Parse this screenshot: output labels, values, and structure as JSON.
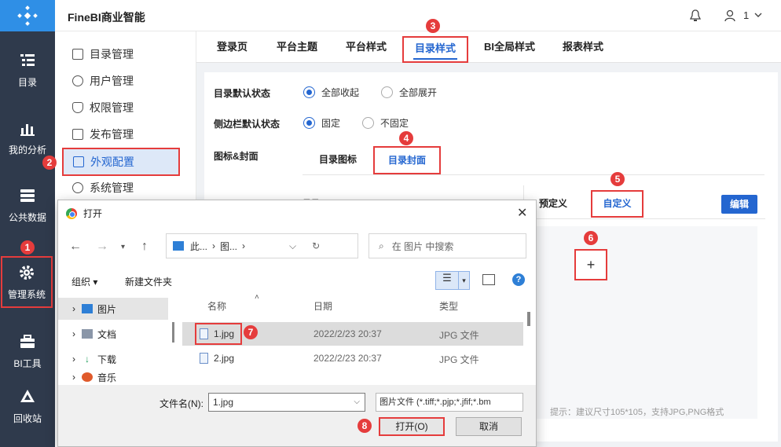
{
  "app": {
    "title": "FineBI商业智能",
    "user": "1"
  },
  "leftnav": [
    {
      "label": "目录"
    },
    {
      "label": "我的分析"
    },
    {
      "label": "公共数据"
    },
    {
      "label": "管理系统"
    },
    {
      "label": "BI工具"
    },
    {
      "label": "回收站"
    }
  ],
  "sidebar": [
    {
      "label": "目录管理"
    },
    {
      "label": "用户管理"
    },
    {
      "label": "权限管理"
    },
    {
      "label": "发布管理"
    },
    {
      "label": "外观配置"
    },
    {
      "label": "系统管理"
    }
  ],
  "tabs": [
    "登录页",
    "平台主题",
    "平台样式",
    "目录样式",
    "BI全局样式",
    "报表样式"
  ],
  "settings": {
    "dir_default": {
      "label": "目录默认状态",
      "options": [
        "全部收起",
        "全部展开"
      ],
      "selected": 0
    },
    "sidebar_default": {
      "label": "侧边栏默认状态",
      "options": [
        "固定",
        "不固定"
      ],
      "selected": 0
    },
    "icon_cover": {
      "label": "图标&封面"
    },
    "subtabs": [
      "目录图标",
      "目录封面"
    ],
    "cover_partial_label": "目录",
    "cover_tabs": [
      "预定义",
      "自定义"
    ],
    "edit_label": "编辑",
    "plus": "+",
    "hint": "提示：建议尺寸105*105，支持JPG,PNG格式"
  },
  "badges": [
    "1",
    "2",
    "3",
    "4",
    "5",
    "6",
    "7",
    "8"
  ],
  "dialog": {
    "title": "打开",
    "address": [
      "此...",
      "图..."
    ],
    "search_placeholder": "在 图片 中搜索",
    "organize": "组织 ▾",
    "new_folder": "新建文件夹",
    "tree": [
      "图片",
      "文档",
      "下载",
      "音乐"
    ],
    "columns": [
      "名称",
      "日期",
      "类型"
    ],
    "files": [
      {
        "name": "1.jpg",
        "date": "2022/2/23 20:37",
        "type": "JPG 文件"
      },
      {
        "name": "2.jpg",
        "date": "2022/2/23 20:37",
        "type": "JPG 文件"
      }
    ],
    "filename_label": "文件名(N):",
    "filename_value": "1.jpg",
    "filetype": "图片文件 (*.tiff;*.pjp;*.jfif;*.bm",
    "open_label": "打开(O)",
    "cancel_label": "取消"
  },
  "colors": {
    "accent": "#2466d0",
    "nav_bg": "#2f3a4c",
    "highlight": "#e53c3c"
  }
}
